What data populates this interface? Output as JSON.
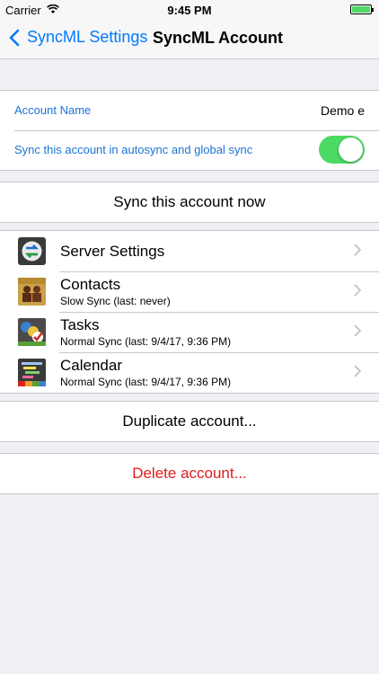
{
  "status": {
    "carrier": "Carrier",
    "time": "9:45 PM"
  },
  "nav": {
    "back_label": "SyncML Settings",
    "title": "SyncML Account"
  },
  "account": {
    "name_label": "Account Name",
    "name_value": "Demo e",
    "sync_label": "Sync this account in autosync and global sync",
    "sync_enabled": true
  },
  "actions": {
    "sync_now": "Sync this account now",
    "duplicate": "Duplicate account...",
    "delete": "Delete account..."
  },
  "items": [
    {
      "title": "Server Settings",
      "subtitle": "",
      "icon": "server-settings-icon"
    },
    {
      "title": "Contacts",
      "subtitle": "Slow Sync (last: never)",
      "icon": "contacts-icon"
    },
    {
      "title": "Tasks",
      "subtitle": "Normal Sync (last: 9/4/17, 9:36 PM)",
      "icon": "tasks-icon"
    },
    {
      "title": "Calendar",
      "subtitle": "Normal Sync (last: 9/4/17, 9:36 PM)",
      "icon": "calendar-icon"
    }
  ],
  "colors": {
    "accent": "#007aff",
    "toggle_on": "#4cd964",
    "destructive": "#e01b1b"
  }
}
